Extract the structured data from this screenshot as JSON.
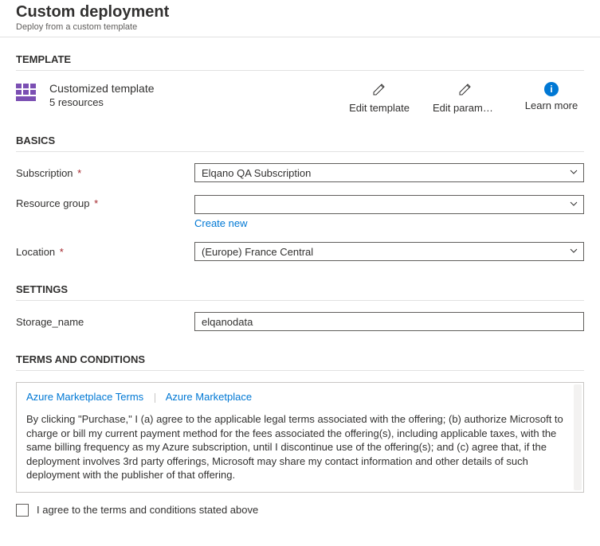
{
  "header": {
    "title": "Custom deployment",
    "subtitle": "Deploy from a custom template"
  },
  "template_section": {
    "label": "TEMPLATE",
    "name": "Customized template",
    "resources": "5 resources",
    "actions": {
      "edit_template": "Edit template",
      "edit_parameters": "Edit paramet…",
      "learn_more": "Learn more"
    }
  },
  "basics": {
    "label": "BASICS",
    "subscription": {
      "label": "Subscription",
      "value": "Elqano QA Subscription"
    },
    "resource_group": {
      "label": "Resource group",
      "value": "",
      "create_new": "Create new"
    },
    "location": {
      "label": "Location",
      "value": "(Europe) France Central"
    }
  },
  "settings": {
    "label": "SETTINGS",
    "storage_name": {
      "label": "Storage_name",
      "value": "elqanodata"
    }
  },
  "terms": {
    "label": "TERMS AND CONDITIONS",
    "link1": "Azure Marketplace Terms",
    "link2": "Azure Marketplace",
    "body": "By clicking \"Purchase,\" I (a) agree to the applicable legal terms associated with the offering; (b) authorize Microsoft to charge or bill my current payment method for the fees associated the offering(s), including applicable taxes, with the same billing frequency as my Azure subscription, until I discontinue use of the offering(s); and (c) agree that, if the deployment involves 3rd party offerings, Microsoft may share my contact information and other details of such deployment with the publisher of that offering.",
    "agree": "I agree to the terms and conditions stated above"
  }
}
